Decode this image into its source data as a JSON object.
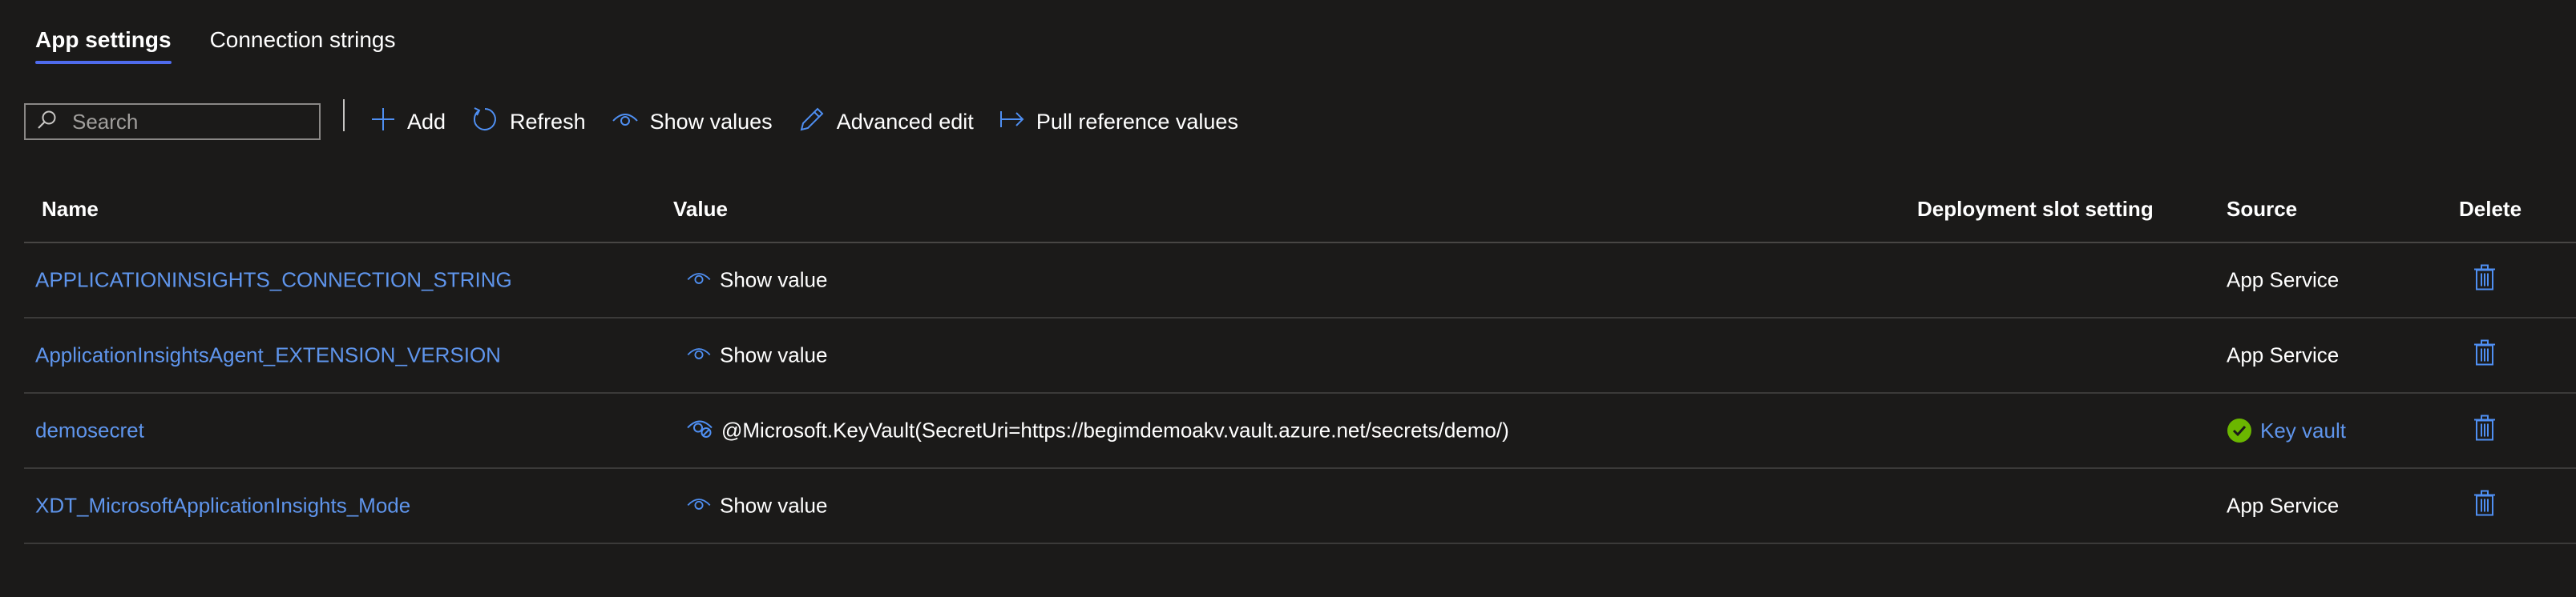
{
  "tabs": [
    {
      "label": "App settings",
      "active": true
    },
    {
      "label": "Connection strings",
      "active": false
    }
  ],
  "search": {
    "placeholder": "Search",
    "value": ""
  },
  "toolbar": {
    "add": "Add",
    "refresh": "Refresh",
    "show_values": "Show values",
    "advanced_edit": "Advanced edit",
    "pull_reference": "Pull reference values"
  },
  "table": {
    "headers": {
      "name": "Name",
      "value": "Value",
      "deployment": "Deployment slot setting",
      "source": "Source",
      "delete": "Delete"
    },
    "rows": [
      {
        "name": "APPLICATIONINSIGHTS_CONNECTION_STRING",
        "value": "Show value",
        "source": "App Service"
      },
      {
        "name": "ApplicationInsightsAgent_EXTENSION_VERSION",
        "value": "Show value",
        "source": "App Service"
      },
      {
        "name": "demosecret",
        "value": "@Microsoft.KeyVault(SecretUri=https://begimdemoakv.vault.azure.net/secrets/demo/)",
        "source": "Key vault"
      },
      {
        "name": "XDT_MicrosoftApplicationInsights_Mode",
        "value": "Show value",
        "source": "App Service"
      }
    ]
  },
  "colors": {
    "accent": "#4f6bed",
    "link": "#5f95ec",
    "success": "#6bb700"
  }
}
